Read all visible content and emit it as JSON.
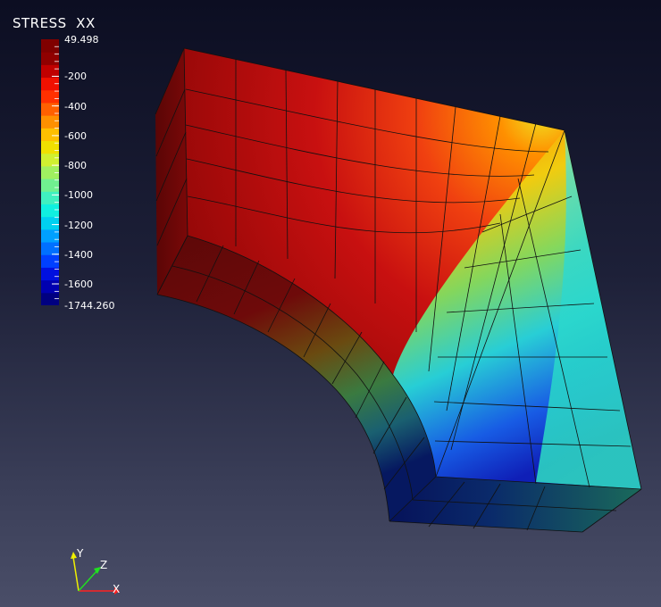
{
  "legend": {
    "title": "STRESS  XX",
    "max_label": "49.498",
    "min_label": "-1744.260",
    "ticks": [
      {
        "label": "-200",
        "value": -200
      },
      {
        "label": "-400",
        "value": -400
      },
      {
        "label": "-600",
        "value": -600
      },
      {
        "label": "-800",
        "value": -800
      },
      {
        "label": "-1000",
        "value": -1000
      },
      {
        "label": "-1200",
        "value": -1200
      },
      {
        "label": "-1400",
        "value": -1400
      },
      {
        "label": "-1600",
        "value": -1600
      }
    ],
    "range": [
      -1744.26,
      49.498
    ],
    "band_colors": [
      "#000080",
      "#0000b0",
      "#0010e0",
      "#0040ff",
      "#0070ff",
      "#00a0ff",
      "#00d0f0",
      "#10f0e0",
      "#40f0c0",
      "#70f090",
      "#a0f060",
      "#d0f030",
      "#f0e000",
      "#ffc000",
      "#ff9000",
      "#ff6000",
      "#ff3000",
      "#f01000",
      "#c00000",
      "#900000",
      "#800000"
    ]
  },
  "axes_triad": {
    "x_label": "X",
    "y_label": "Y",
    "z_label": "Z",
    "x_color": "#ff2020",
    "y_color": "#f0f000",
    "z_color": "#20e020"
  }
}
